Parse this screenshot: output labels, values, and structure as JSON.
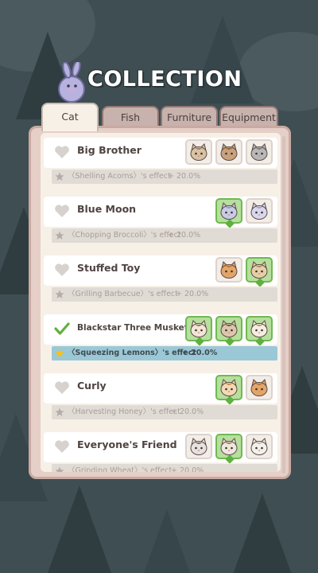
{
  "header": {
    "title": "COLLECTION",
    "mascot_icon": "bunny-mascot-icon"
  },
  "tabs": [
    {
      "label": "Cat",
      "active": true
    },
    {
      "label": "Fish",
      "active": false
    },
    {
      "label": "Furniture",
      "active": false
    },
    {
      "label": "Equipment",
      "active": false
    }
  ],
  "colors": {
    "panel": "#e5cfc7",
    "owned_slot": "#b7df9d",
    "owned_border": "#70b853",
    "active_effect": "#9bc8d6"
  },
  "entries": [
    {
      "name": "Big Brother",
      "completed": false,
      "cats": [
        {
          "kind": "tabby",
          "owned": false
        },
        {
          "kind": "brown",
          "owned": false
        },
        {
          "kind": "grey",
          "owned": false
        }
      ],
      "effect_text": "〈Shelling Acorns〉's effect",
      "effect_value": "+ 20.0%"
    },
    {
      "name": "Blue Moon",
      "completed": false,
      "cats": [
        {
          "kind": "blue",
          "owned": true
        },
        {
          "kind": "lavender",
          "owned": false
        }
      ],
      "effect_text": "〈Chopping Broccoli〉's effect",
      "effect_value": "+ 20.0%"
    },
    {
      "name": "Stuffed Toy",
      "completed": false,
      "cats": [
        {
          "kind": "orange",
          "owned": false
        },
        {
          "kind": "beige",
          "owned": true
        }
      ],
      "effect_text": "〈Grilling Barbecue〉's effect",
      "effect_value": "+ 20.0%"
    },
    {
      "name": "Blackstar Three Musketeers",
      "completed": true,
      "cats": [
        {
          "kind": "siamese",
          "owned": true
        },
        {
          "kind": "siamese-dark",
          "owned": true
        },
        {
          "kind": "siamese-light",
          "owned": true
        }
      ],
      "effect_text": "〈Squeezing Lemons〉's effect",
      "effect_value": "+ 20.0%"
    },
    {
      "name": "Curly",
      "completed": false,
      "cats": [
        {
          "kind": "calico",
          "owned": true
        },
        {
          "kind": "orange",
          "owned": false
        }
      ],
      "effect_text": "〈Harvesting Honey〉's effect",
      "effect_value": "+ 20.0%"
    },
    {
      "name": "Everyone's Friend",
      "completed": false,
      "cats": [
        {
          "kind": "tuxedo",
          "owned": false
        },
        {
          "kind": "tri",
          "owned": true
        },
        {
          "kind": "white",
          "owned": false
        }
      ],
      "effect_text": "〈Grinding Wheat〉's effect",
      "effect_value": "+ 20.0%"
    }
  ]
}
